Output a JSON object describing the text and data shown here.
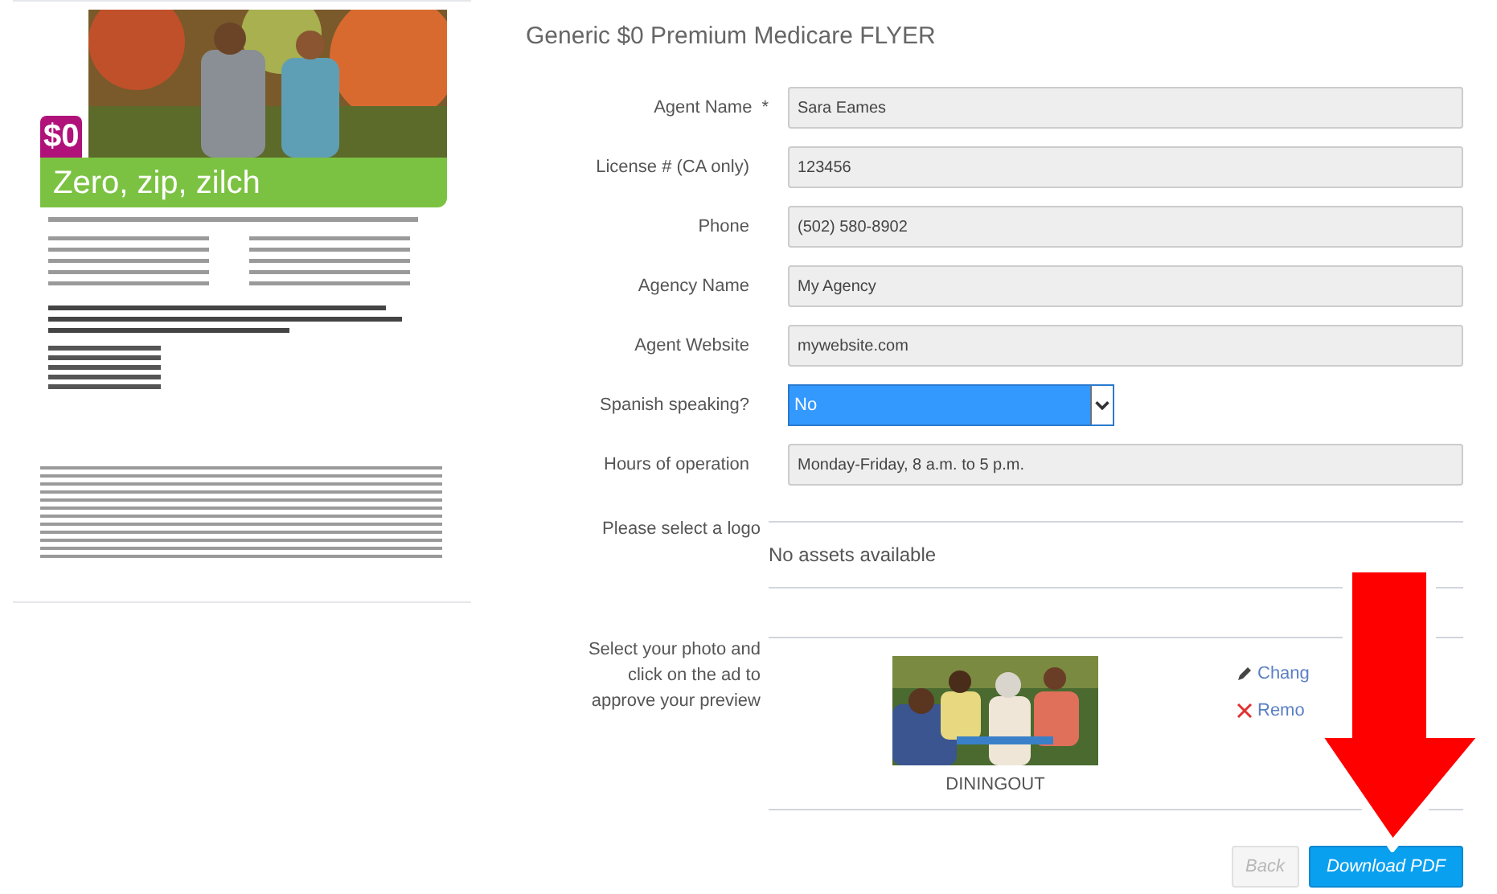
{
  "flyer_preview": {
    "badge": "$0",
    "headline": "Zero, zip, zilch"
  },
  "title": "Generic $0 Premium Medicare FLYER",
  "fields": [
    {
      "kind": "text",
      "label": "Agent Name",
      "required_mark": "*",
      "value": "Sara Eames"
    },
    {
      "kind": "text",
      "label": "License # (CA only)",
      "value": "123456"
    },
    {
      "kind": "text",
      "label": "Phone",
      "value": "(502) 580-8902"
    },
    {
      "kind": "text",
      "label": "Agency Name",
      "value": "My Agency"
    },
    {
      "kind": "text",
      "label": "Agent Website",
      "value": "mywebsite.com"
    },
    {
      "kind": "select",
      "label": "Spanish speaking?",
      "value": "No"
    },
    {
      "kind": "text",
      "label": "Hours of operation",
      "value": "Monday-Friday, 8 a.m. to 5 p.m."
    }
  ],
  "logo": {
    "label": "Please select a logo",
    "message": "No assets available"
  },
  "photo": {
    "label": "Select your photo and click on the ad to approve your preview",
    "caption": "DININGOUT",
    "change": "Chang",
    "remove": "Remo"
  },
  "buttons": [
    {
      "label": "Back",
      "kind": "secondary",
      "disabled": true
    },
    {
      "label": "Download PDF",
      "kind": "primary",
      "disabled": false
    }
  ]
}
